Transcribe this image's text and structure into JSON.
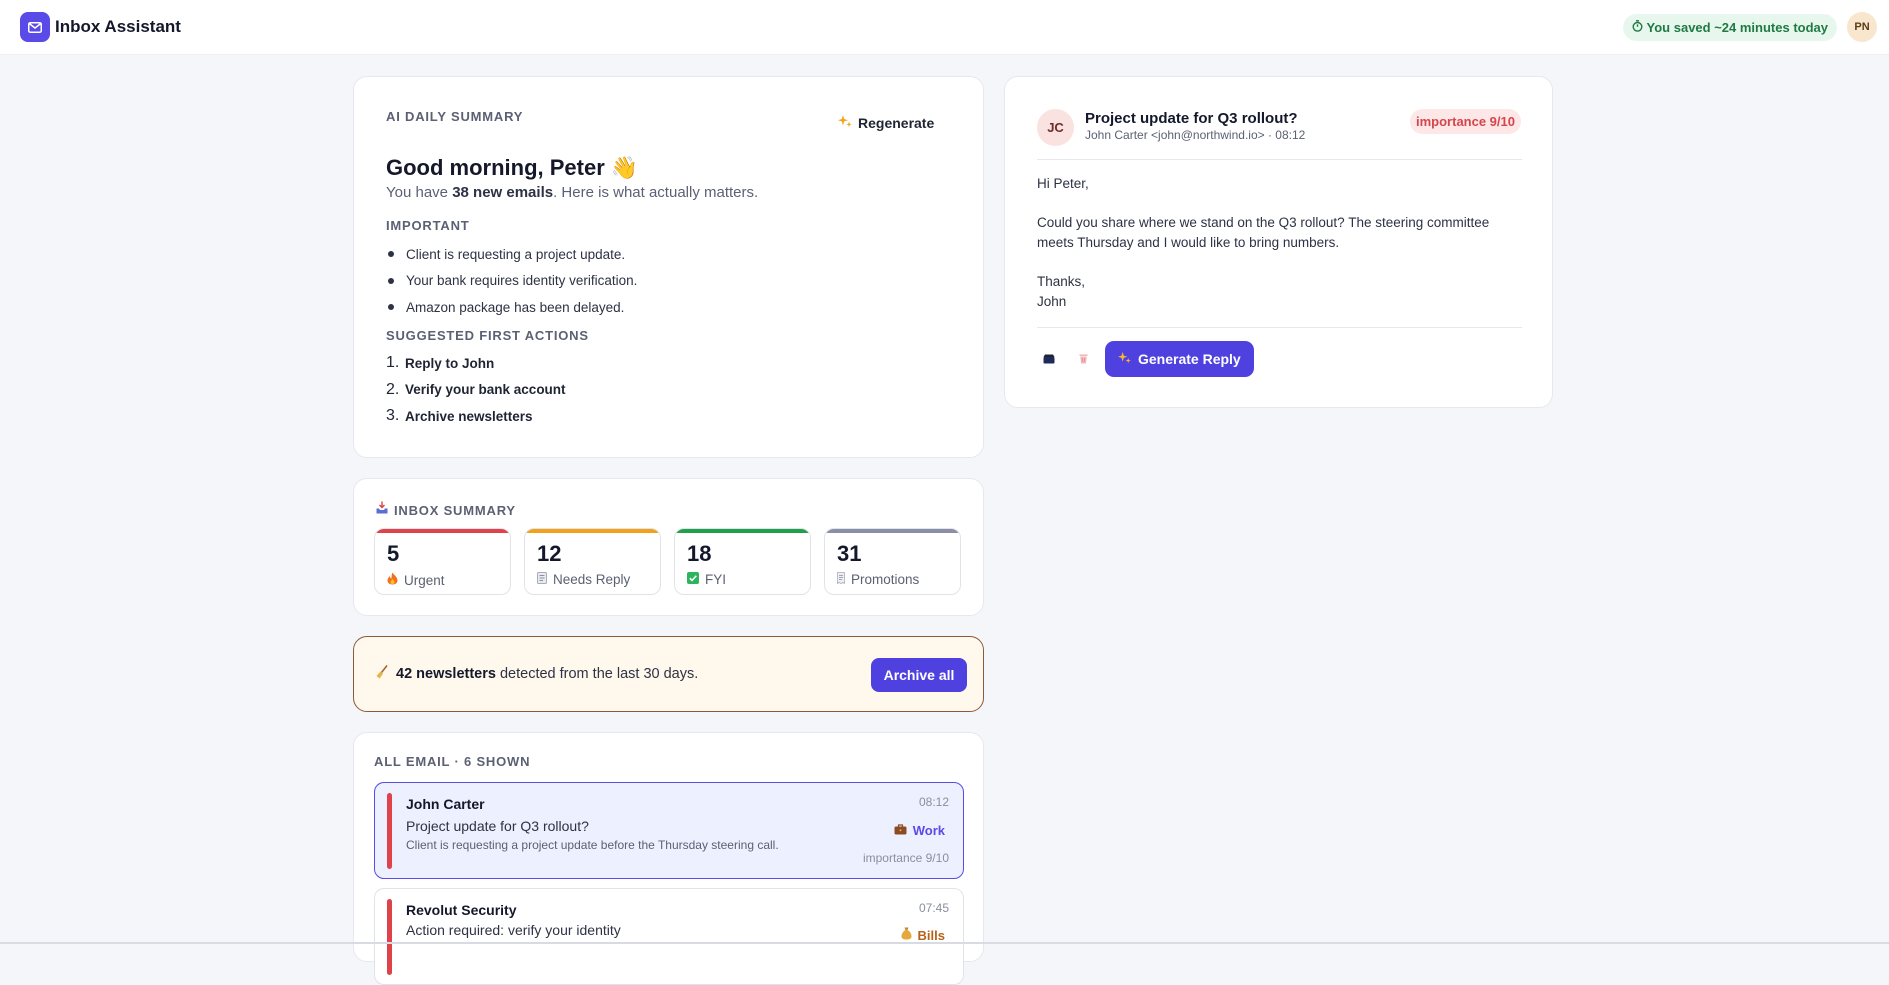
{
  "app": {
    "name": "Inbox Assistant",
    "saved_text": "You saved ~24 minutes today",
    "user_initials": "PN"
  },
  "ai_summary": {
    "label": "AI DAILY SUMMARY",
    "regenerate_label": "Regenerate",
    "greeting": "Good morning, Peter 👋",
    "sub_prefix": "You have ",
    "sub_count": "38 new emails",
    "sub_suffix": ". Here is what actually matters.",
    "important_label": "IMPORTANT",
    "important": [
      "Client is requesting a project update.",
      "Your bank requires identity verification.",
      "Amazon package has been delayed."
    ],
    "actions_label": "SUGGESTED FIRST ACTIONS",
    "actions": [
      {
        "num": "1.",
        "text": "Reply to John"
      },
      {
        "num": "2.",
        "text": "Verify your bank account"
      },
      {
        "num": "3.",
        "text": "Archive newsletters"
      }
    ]
  },
  "inbox_summary": {
    "label": "INBOX SUMMARY",
    "tiles": [
      {
        "count": "5",
        "label": "Urgent",
        "icon": "fire-icon",
        "color": "#e0424a"
      },
      {
        "count": "12",
        "label": "Needs Reply",
        "icon": "memo-icon",
        "color": "#f0a21c"
      },
      {
        "count": "18",
        "label": "FYI",
        "icon": "check-icon",
        "color": "#1fa04a"
      },
      {
        "count": "31",
        "label": "Promotions",
        "icon": "receipt-icon",
        "color": "#8b8fa3"
      }
    ]
  },
  "newsletter": {
    "count_text": "42 newsletters",
    "rest_text": " detected from the last 30 days.",
    "button": "Archive all"
  },
  "email_list": {
    "label": "ALL EMAIL · 6 SHOWN",
    "emails": [
      {
        "sender": "John Carter",
        "time": "08:12",
        "subject": "Project update for Q3 rollout?",
        "preview": "Client is requesting a project update before the Thursday steering call.",
        "tag": "Work",
        "tag_icon": "briefcase-icon",
        "tag_color": "#5a4ae8",
        "importance": "importance 9/10"
      },
      {
        "sender": "Revolut Security",
        "time": "07:45",
        "subject": "Action required: verify your identity",
        "preview": "",
        "tag": "Bills",
        "tag_icon": "money-bag-icon",
        "tag_color": "#b6621a",
        "importance": ""
      }
    ]
  },
  "detail": {
    "initials": "JC",
    "subject": "Project update for Q3 rollout?",
    "from": "John Carter <john@northwind.io> · 08:12",
    "importance": "importance 9/10",
    "body": [
      "Hi Peter,",
      "Could you share where we stand on the Q3 rollout? The steering committee meets Thursday and I would like to bring numbers.",
      "Thanks,\nJohn"
    ],
    "generate_label": "Generate Reply"
  },
  "colors": {
    "accent": "#4e41e0",
    "urgent": "#e0424a"
  }
}
